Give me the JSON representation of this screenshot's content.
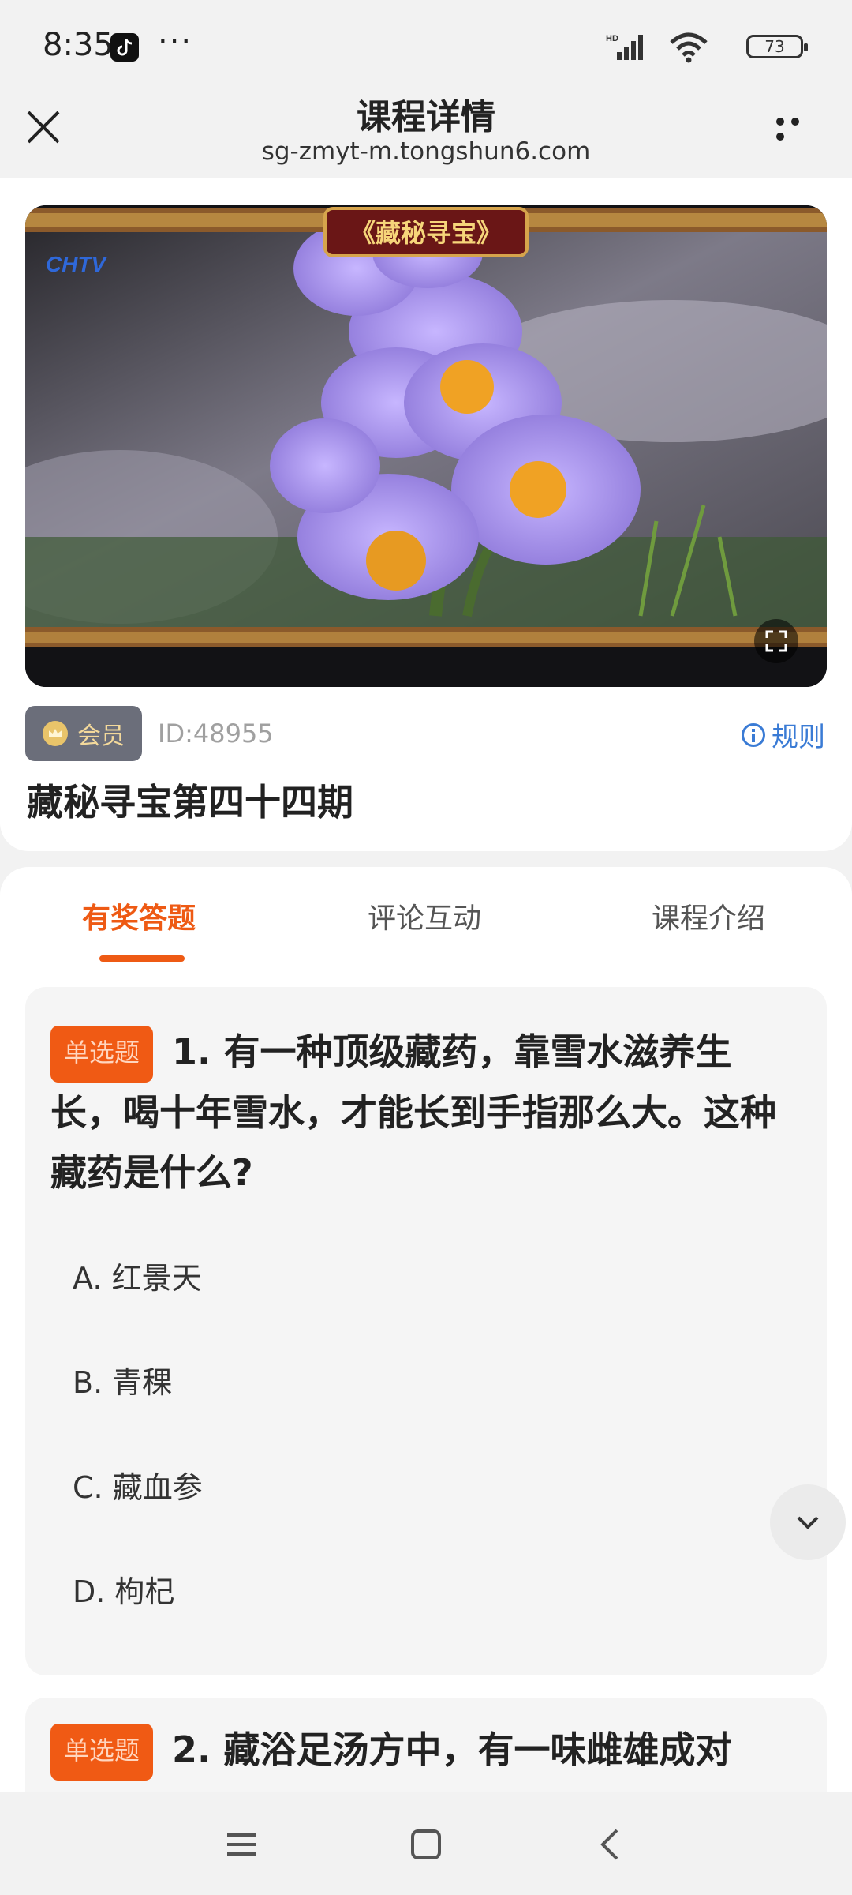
{
  "status_bar": {
    "time": "8:35",
    "dots": "···",
    "battery": "73",
    "icons": [
      "tiktok-icon",
      "signal-icon",
      "wifi-icon",
      "battery-icon"
    ]
  },
  "header": {
    "title": "课程详情",
    "url": "sg-zmyt-m.tongshun6.com",
    "icons": [
      "close-icon",
      "more-icon"
    ]
  },
  "course": {
    "video_logo": "CHTV",
    "video_banner": "《藏秘寻宝》",
    "member_label": "会员",
    "id_text": "ID:48955",
    "rules_label": "规则",
    "title": "藏秘寻宝第四十四期"
  },
  "tabs": [
    {
      "label": "有奖答题",
      "active": true
    },
    {
      "label": "评论互动",
      "active": false
    },
    {
      "label": "课程介绍",
      "active": false
    }
  ],
  "questions": [
    {
      "type": "单选题",
      "text": "1. 有一种顶级藏药，靠雪水滋养生长，喝十年雪水，才能长到手指那么大。这种藏药是什么?",
      "options": [
        "A. 红景天",
        "B. 青稞",
        "C. 藏血参",
        "D. 枸杞"
      ]
    },
    {
      "type": "单选题",
      "text": "2. 藏浴足汤方中，有一味雌雄成对"
    }
  ],
  "colors": {
    "accent": "#ee5a14",
    "link": "#3a7bd5",
    "member_badge_bg": "#6b6e7a"
  },
  "nav_bar": {
    "icons": [
      "menu-icon",
      "home-icon",
      "back-icon"
    ]
  }
}
